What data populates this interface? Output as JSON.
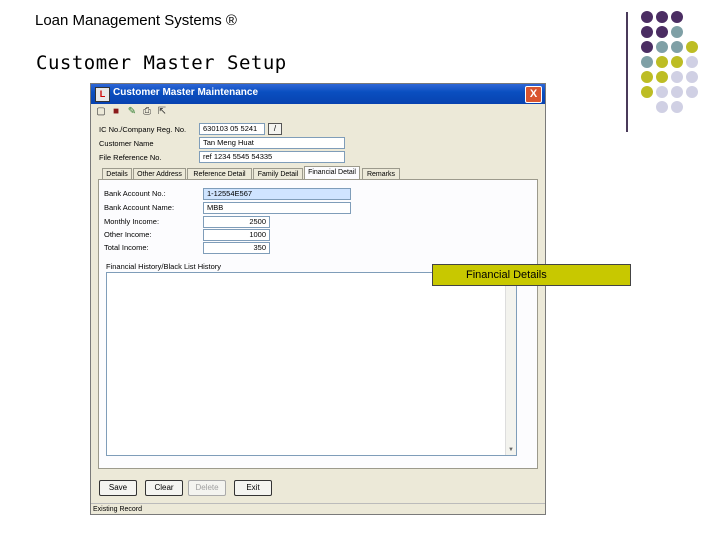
{
  "slide": {
    "title": "Loan Management Systems ®",
    "subtitle": "Customer Master Setup"
  },
  "deco": {
    "colors": {
      "purple": "#4b2d63",
      "teal": "#7fa0a6",
      "olive": "#bdbd24",
      "lavender": "#d0d0e4"
    }
  },
  "window": {
    "title": "Customer Master Maintenance",
    "icon": "app-icon",
    "close_label": "X",
    "toolbar_icons": [
      "new-icon",
      "delete-icon",
      "edit-icon",
      "print-icon",
      "export-icon"
    ],
    "header_fields": {
      "ic_label": "IC No./Company Reg. No.",
      "ic_value": "630103 05 5241",
      "ic_lookup": "/",
      "name_label": "Customer Name",
      "name_value": "Tan Meng Huat",
      "file_label": "File Reference No.",
      "file_value": "ref 1234 5545 54335"
    },
    "tabs": [
      "Details",
      "Other Address",
      "Reference Detail",
      "Family Detail",
      "Financial Detail",
      "Remarks"
    ],
    "active_tab": "Financial Detail",
    "financial": {
      "bank_account_no_label": "Bank Account No.:",
      "bank_account_no_value": "1-12554E567",
      "bank_account_name_label": "Bank Account Name:",
      "bank_account_name_value": "MBB",
      "monthly_income_label": "Monthly Income:",
      "monthly_income_value": "2500",
      "other_income_label": "Other Income:",
      "other_income_value": "1000",
      "total_income_label": "Total Income:",
      "total_income_value": "350",
      "history_label": "Financial History/Black List History"
    },
    "buttons": {
      "save": "Save",
      "clear": "Clear",
      "delete": "Delete",
      "exit": "Exit"
    },
    "status": "Existing Record"
  },
  "callout": {
    "text": "Financial Details",
    "color": "#c8c800"
  }
}
